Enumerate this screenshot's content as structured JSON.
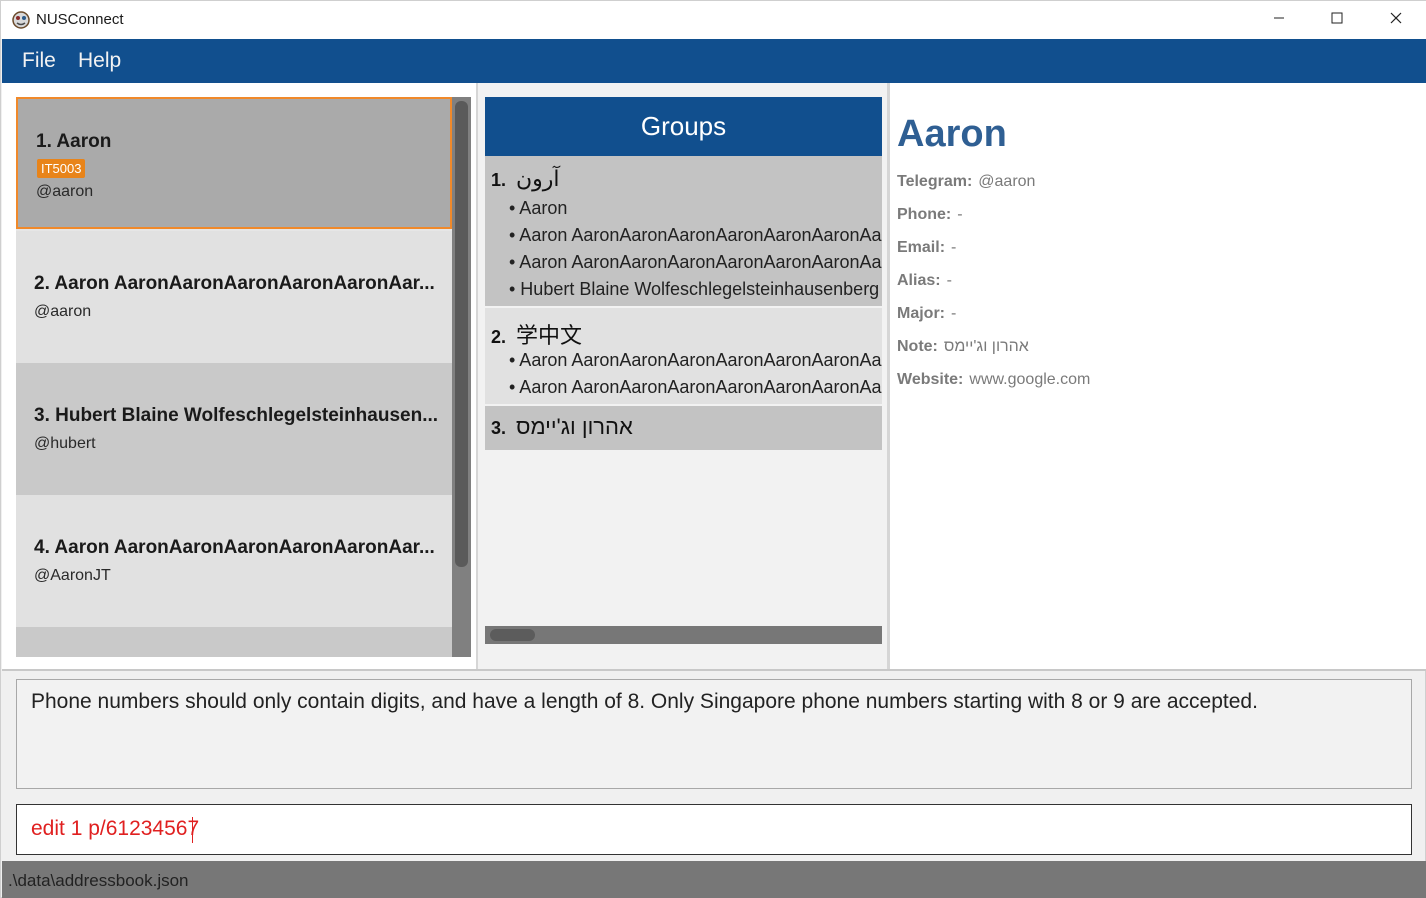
{
  "window": {
    "title": "NUSConnect"
  },
  "menu": {
    "file": "File",
    "help": "Help"
  },
  "persons": [
    {
      "index_name": "1. Aaron",
      "tag": "IT5003",
      "handle": "@aaron"
    },
    {
      "index_name": "2. Aaron AaronAaronAaronAaronAaronAar...",
      "handle": "@aaron"
    },
    {
      "index_name": "3. Hubert Blaine Wolfeschlegelsteinhausen...",
      "handle": "@hubert"
    },
    {
      "index_name": "4. Aaron AaronAaronAaronAaronAaronAar...",
      "handle": "@AaronJT"
    }
  ],
  "groups": {
    "header": "Groups",
    "items": [
      {
        "num": "1.",
        "name": "آرون",
        "members": [
          "• Aaron",
          "• Aaron AaronAaronAaronAaronAaronAaronAa",
          "• Aaron AaronAaronAaronAaronAaronAaronAa",
          "• Hubert Blaine Wolfeschlegelsteinhausenberg"
        ]
      },
      {
        "num": "2.",
        "name": "学中文",
        "members": [
          "• Aaron AaronAaronAaronAaronAaronAaronAa",
          "• Aaron AaronAaronAaronAaronAaronAaronAa"
        ]
      },
      {
        "num": "3.",
        "name": "אהרון וג'יימס",
        "members": []
      }
    ]
  },
  "details": {
    "name": "Aaron",
    "rows": [
      {
        "label": "Telegram:",
        "value": "@aaron"
      },
      {
        "label": "Phone:",
        "value": "-"
      },
      {
        "label": "Email:",
        "value": "-"
      },
      {
        "label": "Alias:",
        "value": "-"
      },
      {
        "label": "Major:",
        "value": "-"
      },
      {
        "label": "Note:",
        "value": "אהרון וג'יימס"
      },
      {
        "label": "Website:",
        "value": "www.google.com"
      }
    ]
  },
  "result": {
    "message": "Phone numbers should only contain digits, and have a length of 8. Only Singapore phone numbers starting with 8 or 9 are accepted."
  },
  "command": {
    "value": "edit 1 p/61234567"
  },
  "status": {
    "path": ".\\data\\addressbook.json"
  },
  "colors": {
    "menu_bar": "#114f8e",
    "tag": "#e8841a",
    "selected_border": "#f0892a",
    "detail_name": "#2f5f93",
    "command_text": "#e02020"
  },
  "icons": [
    "app-icon",
    "minimize-icon",
    "maximize-icon",
    "close-icon"
  ]
}
